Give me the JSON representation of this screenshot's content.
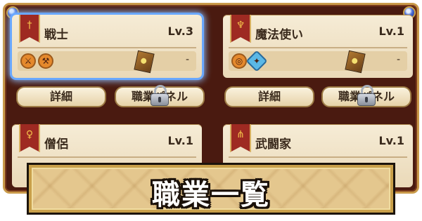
{
  "page_title": "職業一覧",
  "jobs": [
    {
      "name": "戦士",
      "level": "Lv.3",
      "emblem": "sword",
      "weapon_icons": [
        "sword-icon",
        "axe-icon"
      ],
      "sub_value": "-",
      "selected": true
    },
    {
      "name": "魔法使い",
      "level": "Lv.1",
      "emblem": "staff",
      "weapon_icons": [
        "whip-icon",
        "wand-icon"
      ],
      "sub_value": "-",
      "selected": false
    },
    {
      "name": "僧侶",
      "level": "Lv.1",
      "emblem": "scepter",
      "selected": false
    },
    {
      "name": "武闘家",
      "level": "Lv.1",
      "emblem": "claw",
      "selected": false
    }
  ],
  "buttons": {
    "detail_label": "詳細",
    "job_panel_label": "職業パネル"
  },
  "colors": {
    "frame": "#4a1a10",
    "card": "#f1e4c8",
    "banner": "#9e2a22",
    "selection_glow": "#8ec0ff",
    "title_plate": "#e4c78e"
  }
}
